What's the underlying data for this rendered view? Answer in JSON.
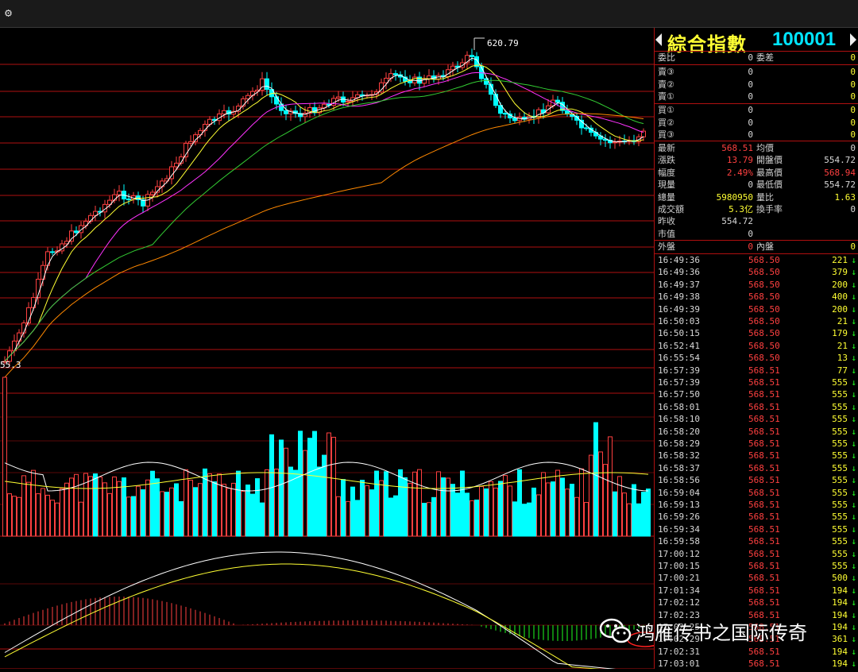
{
  "toolbar": {
    "settings_icon": "gear-icon"
  },
  "header": {
    "name": "綜合指數",
    "code": "100001",
    "prev_icon": "arrow-left-icon",
    "next_icon": "arrow-right-icon"
  },
  "colors": {
    "up": "#ff4040",
    "down": "#00ffff",
    "bg": "#000000",
    "grid": "#b01010",
    "label": "#ffff33"
  },
  "annotations": {
    "high_label": "620.79",
    "low_label": "55.3"
  },
  "quote": {
    "weibi": {
      "label": "委比",
      "value": "0"
    },
    "weicha": {
      "label": "委差",
      "value": "0"
    },
    "sell": [
      {
        "label": "賣③",
        "price": "0",
        "vol": "0"
      },
      {
        "label": "賣②",
        "price": "0",
        "vol": "0"
      },
      {
        "label": "賣①",
        "price": "0",
        "vol": "0"
      }
    ],
    "buy": [
      {
        "label": "買①",
        "price": "0",
        "vol": "0"
      },
      {
        "label": "買②",
        "price": "0",
        "vol": "0"
      },
      {
        "label": "買③",
        "price": "0",
        "vol": "0"
      }
    ],
    "stats": [
      {
        "l1": "最新",
        "v1": "568.51",
        "c1": "r",
        "l2": "均價",
        "v2": "0",
        "c2": "w"
      },
      {
        "l1": "漲跌",
        "v1": "13.79",
        "c1": "r",
        "l2": "開盤價",
        "v2": "554.72",
        "c2": "w"
      },
      {
        "l1": "幅度",
        "v1": "2.49%",
        "c1": "r",
        "l2": "最高價",
        "v2": "568.94",
        "c2": "r"
      },
      {
        "l1": "現量",
        "v1": "0",
        "c1": "w",
        "l2": "最低價",
        "v2": "554.72",
        "c2": "w"
      },
      {
        "l1": "總量",
        "v1": "5980950",
        "c1": "y",
        "l2": "量比",
        "v2": "1.63",
        "c2": "y"
      },
      {
        "l1": "成交額",
        "v1": "5.3亿",
        "c1": "y",
        "l2": "換手率",
        "v2": "0",
        "c2": "w"
      },
      {
        "l1": "昨收",
        "v1": "554.72",
        "c1": "w",
        "l2": "",
        "v2": "",
        "c2": "w"
      },
      {
        "l1": "市值",
        "v1": "0",
        "c1": "w",
        "l2": "",
        "v2": "",
        "c2": "w"
      }
    ],
    "outer": {
      "label": "外盤",
      "value": "0"
    },
    "inner": {
      "label": "內盤",
      "value": "0"
    }
  },
  "ticks": [
    {
      "time": "16:49:36",
      "price": "568.50",
      "vol": "221"
    },
    {
      "time": "16:49:36",
      "price": "568.50",
      "vol": "379"
    },
    {
      "time": "16:49:37",
      "price": "568.50",
      "vol": "200"
    },
    {
      "time": "16:49:38",
      "price": "568.50",
      "vol": "400"
    },
    {
      "time": "16:49:39",
      "price": "568.50",
      "vol": "200"
    },
    {
      "time": "16:50:03",
      "price": "568.50",
      "vol": "21"
    },
    {
      "time": "16:50:15",
      "price": "568.50",
      "vol": "179"
    },
    {
      "time": "16:52:41",
      "price": "568.50",
      "vol": "21"
    },
    {
      "time": "16:55:54",
      "price": "568.50",
      "vol": "13"
    },
    {
      "time": "16:57:39",
      "price": "568.51",
      "vol": "77"
    },
    {
      "time": "16:57:39",
      "price": "568.51",
      "vol": "555"
    },
    {
      "time": "16:57:50",
      "price": "568.51",
      "vol": "555"
    },
    {
      "time": "16:58:01",
      "price": "568.51",
      "vol": "555"
    },
    {
      "time": "16:58:10",
      "price": "568.51",
      "vol": "555"
    },
    {
      "time": "16:58:20",
      "price": "568.51",
      "vol": "555"
    },
    {
      "time": "16:58:29",
      "price": "568.51",
      "vol": "555"
    },
    {
      "time": "16:58:32",
      "price": "568.51",
      "vol": "555"
    },
    {
      "time": "16:58:37",
      "price": "568.51",
      "vol": "555"
    },
    {
      "time": "16:58:56",
      "price": "568.51",
      "vol": "555"
    },
    {
      "time": "16:59:04",
      "price": "568.51",
      "vol": "555"
    },
    {
      "time": "16:59:13",
      "price": "568.51",
      "vol": "555"
    },
    {
      "time": "16:59:26",
      "price": "568.51",
      "vol": "555"
    },
    {
      "time": "16:59:34",
      "price": "568.51",
      "vol": "555"
    },
    {
      "time": "16:59:58",
      "price": "568.51",
      "vol": "555"
    },
    {
      "time": "17:00:12",
      "price": "568.51",
      "vol": "555"
    },
    {
      "time": "17:00:15",
      "price": "568.51",
      "vol": "555"
    },
    {
      "time": "17:00:21",
      "price": "568.51",
      "vol": "500"
    },
    {
      "time": "17:01:34",
      "price": "568.51",
      "vol": "194"
    },
    {
      "time": "17:02:12",
      "price": "568.51",
      "vol": "194"
    },
    {
      "time": "17:02:23",
      "price": "568.51",
      "vol": "194"
    },
    {
      "time": "17:02:25",
      "price": "568.51",
      "vol": "194"
    },
    {
      "time": "17:02:29",
      "price": "568.51",
      "vol": "361"
    },
    {
      "time": "17:02:31",
      "price": "568.51",
      "vol": "194"
    },
    {
      "time": "17:03:01",
      "price": "568.51",
      "vol": "194"
    }
  ],
  "watermark": {
    "text": "鸿雁传书之国际传奇",
    "icon": "wechat-icon"
  }
}
